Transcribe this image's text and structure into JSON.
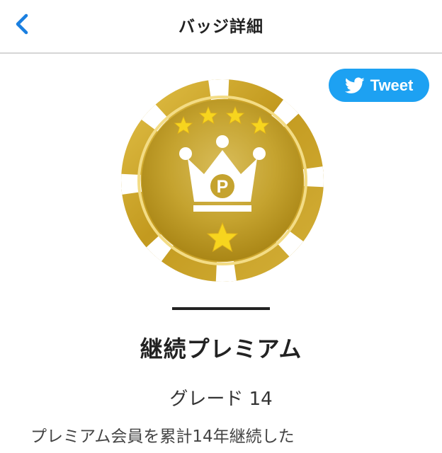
{
  "header": {
    "title": "バッジ詳細",
    "back_icon": "chevron-left-icon"
  },
  "share": {
    "tweet_label": "Tweet",
    "tweet_icon": "twitter-bird-icon",
    "color": "#1da1f2"
  },
  "badge": {
    "name": "継続プレミアム",
    "grade": "グレード 14",
    "description": "プレミアム会員を累計14年継続した",
    "emblem_letter": "P",
    "top_star_count": 4,
    "colors": {
      "gold": "#c9a227",
      "star": "#f7d51e",
      "accent": "#ffffff"
    }
  }
}
